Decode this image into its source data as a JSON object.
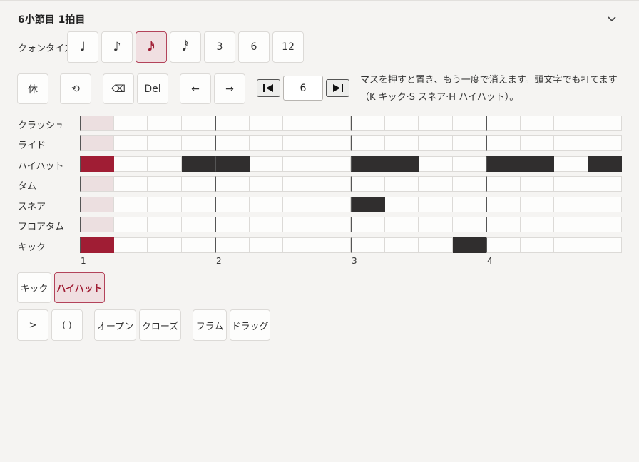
{
  "header": {
    "title": "6小節目 1拍目"
  },
  "quantize": {
    "label": "クォンタイズ",
    "options": [
      "♩",
      "♪",
      "𝅘𝅥𝅯",
      "𝅘𝅥𝅰",
      "3",
      "6",
      "12"
    ],
    "selected_index": 2
  },
  "tools": {
    "rest": "休",
    "undo": "⟲",
    "backspace": "⌫",
    "delete": "Del",
    "left": "←",
    "right": "→"
  },
  "measure": {
    "value": "6"
  },
  "hint": "マスを押すと置き、もう一度で消えます。頭文字でも打てます（K キック·S スネア·H ハイハット）。",
  "grid": {
    "rows": [
      {
        "label": "クラッシュ",
        "cells": "0000000000000000"
      },
      {
        "label": "ライド",
        "cells": "0000000000000000"
      },
      {
        "label": "ハイハット",
        "cells": "1001100011001101"
      },
      {
        "label": "タム",
        "cells": "0000000000000000"
      },
      {
        "label": "スネア",
        "cells": "0000000010000000"
      },
      {
        "label": "フロアタム",
        "cells": "0000000000000000"
      },
      {
        "label": "キック",
        "cells": "1000000000010000"
      }
    ],
    "current_step": 0,
    "beats": [
      "1",
      "2",
      "3",
      "4"
    ]
  },
  "instruments": {
    "items": [
      "キック",
      "ハイハット"
    ],
    "selected_index": 1
  },
  "articulations": {
    "accent": ">",
    "ghost": "( )",
    "open": "オープン",
    "close": "クローズ",
    "flam": "フラム",
    "drag": "ドラッグ"
  },
  "colors": {
    "accent": "#a01d34",
    "note": "#302e2e"
  }
}
